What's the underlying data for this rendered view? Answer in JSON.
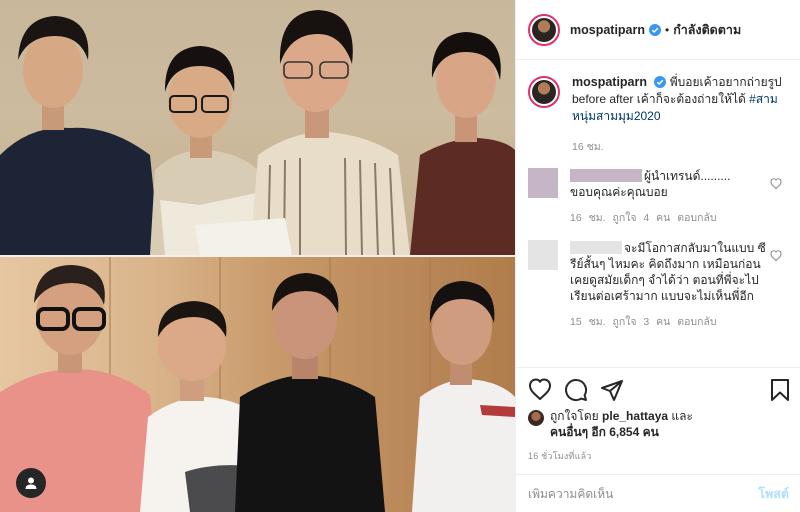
{
  "header": {
    "username": "mospatiparn",
    "separator": "•",
    "follow_status": "กำลังติดตาม"
  },
  "caption": {
    "username": "mospatiparn",
    "text_line1": "พี่บอยเค้าอยากถ่ายรูป",
    "text_line2": "before after เค้าก็จะต้องถ่ายให้ได้",
    "hashtag": "#สามหนุ่มสามมุม2020",
    "time": "16 ชม."
  },
  "comments": [
    {
      "username_suffix": "ผู้นำเทรนด์.........",
      "text": "ขอบคุณค่ะคุณบอย",
      "time": "16 ชม.",
      "likes": "ถูกใจ 4 คน",
      "reply": "ตอบกลับ"
    },
    {
      "text_start": "จะมีโอกาสกลับมาในแบบ",
      "text_rest": "ซีรีย์สั้นๆ ไหมคะ คิดถึงมาก เหมือนก่อนเคยดูสมัยเด็กๆ จำได้ว่า ตอนที่พี่จะไปเรียนต่อเศร้ามาก แบบจะไม่เห็นพี่อีก",
      "time": "15 ชม.",
      "likes": "ถูกใจ 3 คน",
      "reply": "ตอบกลับ"
    }
  ],
  "liked_by": {
    "prefix": "ถูกใจโดย",
    "user": "ple_hattaya",
    "and": "และ",
    "others": "คนอื่นๆ อีก 6,854 คน"
  },
  "post_age": "16 ชั่วโมงที่แล้ว",
  "add_comment": {
    "placeholder": "เพิ่มความคิดเห็น",
    "post_label": "โพสต์"
  },
  "icons": {
    "verified": "verified-badge-icon",
    "heart": "heart-icon",
    "comment": "comment-icon",
    "share": "paper-plane-icon",
    "save": "bookmark-icon",
    "user_tag": "user-icon"
  },
  "colors": {
    "accent_blue": "#3897f0",
    "post_button_disabled": "#b2dffc",
    "hashtag": "#00376b",
    "muted": "#8e8e8e",
    "story_ring": "#e1306c"
  }
}
